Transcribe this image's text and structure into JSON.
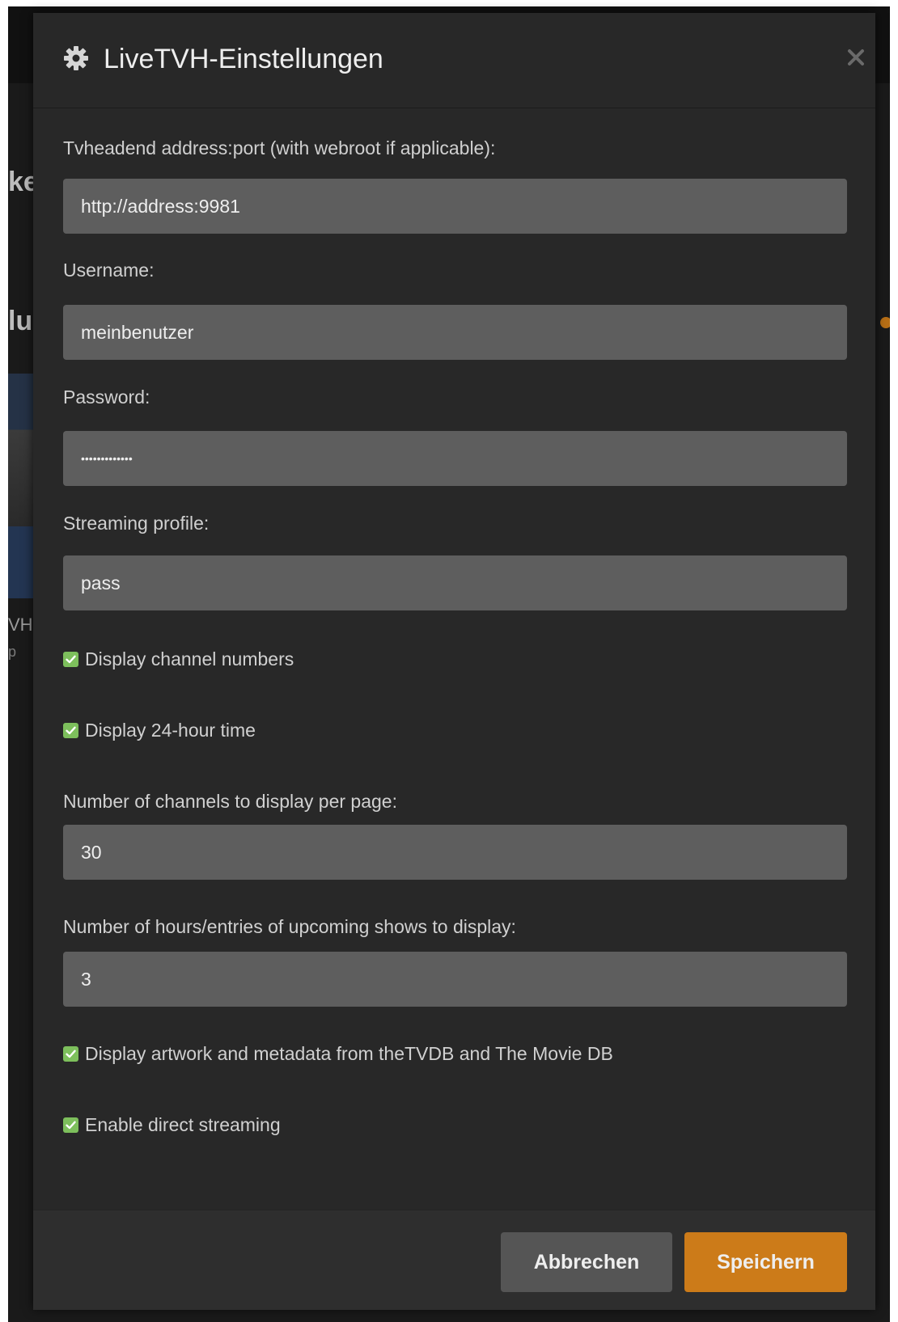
{
  "modal": {
    "title": "LiveTVH-Einstellungen",
    "title_icon": "gear-icon",
    "close_icon": "close-icon"
  },
  "background": {
    "fragments": [
      "ke",
      "lu",
      "VH",
      "p"
    ]
  },
  "fields": {
    "address": {
      "label": "Tvheadend address:port (with webroot if applicable):",
      "value": "http://address:9981"
    },
    "username": {
      "label": "Username:",
      "value": "meinbenutzer"
    },
    "password": {
      "label": "Password:",
      "value": "•••••••••••••"
    },
    "profile": {
      "label": "Streaming profile:",
      "value": "pass"
    },
    "channels_per_page": {
      "label": "Number of channels to display per page:",
      "value": "30"
    },
    "upcoming_hours": {
      "label": "Number of hours/entries of upcoming shows to display:",
      "value": "3"
    }
  },
  "checkboxes": {
    "channel_numbers": {
      "label": "Display channel numbers",
      "checked": true
    },
    "hour24": {
      "label": "Display 24-hour time",
      "checked": true
    },
    "artwork": {
      "label": "Display artwork and metadata from theTVDB and The Movie DB",
      "checked": true
    },
    "direct_streaming": {
      "label": "Enable direct streaming",
      "checked": true
    }
  },
  "footer": {
    "cancel_label": "Abbrechen",
    "save_label": "Speichern"
  },
  "colors": {
    "accent": "#cc7b19",
    "checkbox": "#7dbf5c",
    "modal_bg": "#282828",
    "input_bg": "#5e5e5e"
  }
}
